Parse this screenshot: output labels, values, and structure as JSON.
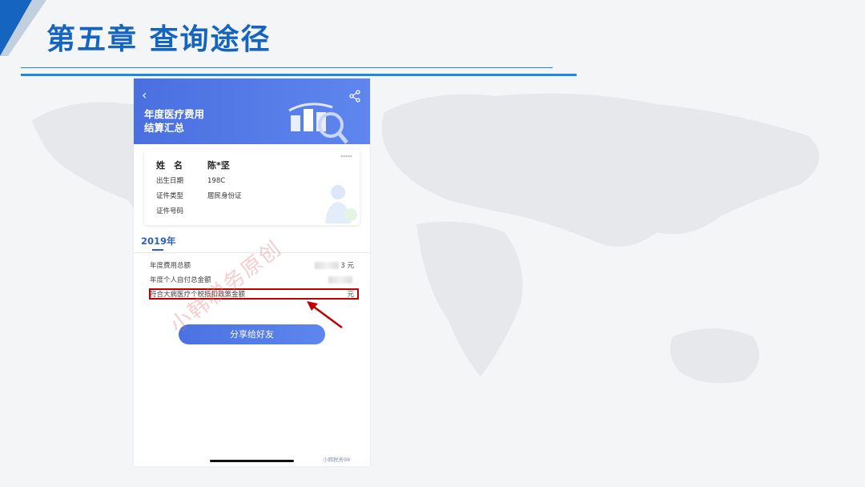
{
  "slide": {
    "title": "第五章 查询途径"
  },
  "phone": {
    "header": {
      "title_line1": "年度医疗费用",
      "title_line2": "结算汇总"
    },
    "info": {
      "name_label": "姓　名",
      "name_value": "陈*坚",
      "birth_label": "出生日期",
      "birth_value": "198C",
      "idtype_label": "证件类型",
      "idtype_value": "居民身份证",
      "idnum_label": "证件号码",
      "idnum_value": "",
      "corner_text": "*****"
    },
    "year": "2019年",
    "rows": [
      {
        "label": "年度费用总额",
        "value": "3 元"
      },
      {
        "label": "年度个人自付总金额",
        "value": ""
      },
      {
        "label": "符合大病医疗个税抵扣政策金额",
        "value": "元"
      }
    ],
    "share_button": "分享给好友",
    "watermark": "小韩税务原创",
    "footer_watermark": "小韩税务98"
  },
  "colors": {
    "accent": "#1e88e5",
    "header_blue": "#4a6fe0",
    "highlight_red": "#c00000"
  }
}
